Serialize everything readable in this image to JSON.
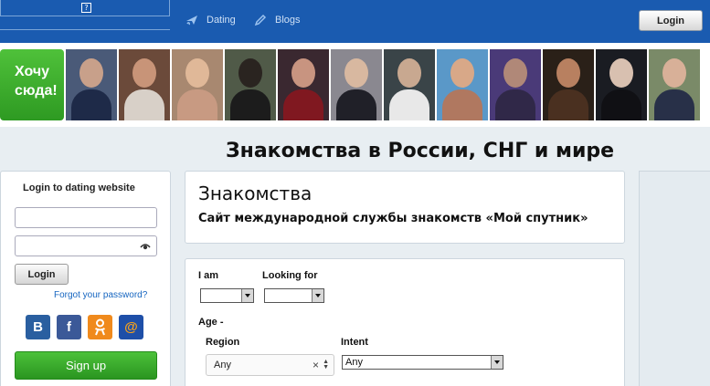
{
  "header": {
    "help_icon": "?",
    "nav": [
      {
        "label": "Dating",
        "icon": "heart-plane-icon"
      },
      {
        "label": "Blogs",
        "icon": "pencil-icon"
      }
    ],
    "login_label": "Login"
  },
  "strip": {
    "want_label_1": "Хочу",
    "want_label_2": "сюда!",
    "photo_count": 12
  },
  "page_title": "Знакомства в России, СНГ и мире",
  "login_panel": {
    "title": "Login to dating website",
    "email_value": "",
    "password_value": "",
    "login_label": "Login",
    "forgot_label": "Forgot your password?",
    "social": [
      {
        "label": "B",
        "icon": "vk-icon"
      },
      {
        "label": "f",
        "icon": "facebook-icon"
      },
      {
        "label": "ok",
        "icon": "odnoklassniki-icon"
      },
      {
        "label": "@",
        "icon": "mailru-icon"
      }
    ],
    "signup_label": "Sign up"
  },
  "intro": {
    "heading": "Знакомства",
    "subheading": "Сайт международной службы знакомств «Мой спутник»"
  },
  "search": {
    "i_am_label": "I am",
    "i_am_value": "",
    "looking_for_label": "Looking for",
    "looking_for_value": "",
    "age_label": "Age -",
    "region_label": "Region",
    "region_value": "Any",
    "intent_label": "Intent",
    "intent_value": "Any"
  },
  "colors": {
    "header_bg": "#1a5bb0",
    "accent_green": "#3aa82b",
    "link_blue": "#1565c0"
  }
}
